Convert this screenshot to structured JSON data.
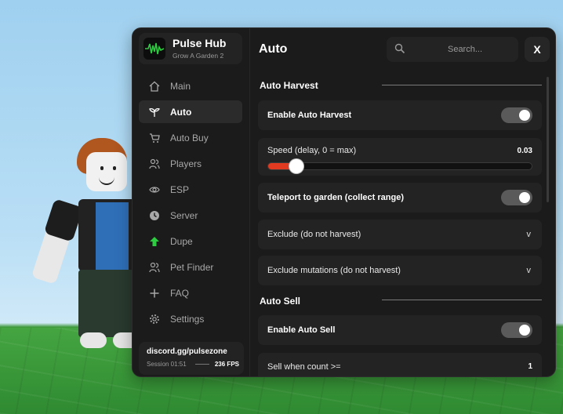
{
  "brand": {
    "title": "Pulse Hub",
    "subtitle": "Grow A Garden 2"
  },
  "nav": [
    {
      "label": "Main",
      "icon": "home-icon",
      "active": false
    },
    {
      "label": "Auto",
      "icon": "sprout-icon",
      "active": true
    },
    {
      "label": "Auto Buy",
      "icon": "cart-icon",
      "active": false
    },
    {
      "label": "Players",
      "icon": "users-icon",
      "active": false
    },
    {
      "label": "ESP",
      "icon": "eye-icon",
      "active": false
    },
    {
      "label": "Server",
      "icon": "clock-icon",
      "active": false
    },
    {
      "label": "Dupe",
      "icon": "arrow-up-icon",
      "active": false
    },
    {
      "label": "Pet Finder",
      "icon": "users-icon",
      "active": false
    },
    {
      "label": "FAQ",
      "icon": "sparkle-icon",
      "active": false
    },
    {
      "label": "Settings",
      "icon": "gear-icon",
      "active": false
    }
  ],
  "footer": {
    "discord": "discord.gg/pulsezone",
    "session": "Session 01:51",
    "fps": "236 FPS"
  },
  "header": {
    "title": "Auto",
    "search_placeholder": "Search...",
    "close_label": "X"
  },
  "sections": {
    "auto_harvest": "Auto Harvest",
    "auto_sell": "Auto Sell"
  },
  "controls": {
    "enable_auto_harvest": {
      "label": "Enable Auto Harvest",
      "on": true
    },
    "speed": {
      "label": "Speed (delay, 0 = max)",
      "value": "0.03",
      "fraction": 0.03
    },
    "teleport": {
      "label": "Teleport to garden (collect range)",
      "on": true
    },
    "exclude": {
      "label": "Exclude (do not harvest)",
      "chevron": "v"
    },
    "exclude_mutations": {
      "label": "Exclude mutations (do not harvest)",
      "chevron": "v"
    },
    "enable_auto_sell": {
      "label": "Enable Auto Sell",
      "on": true
    },
    "sell_when_count": {
      "label": "Sell when count >=",
      "value": "1"
    }
  },
  "colors": {
    "accent": "#e23a20",
    "panel": "#1b1b1b",
    "card": "#232323",
    "logo_green": "#2ecc40"
  }
}
